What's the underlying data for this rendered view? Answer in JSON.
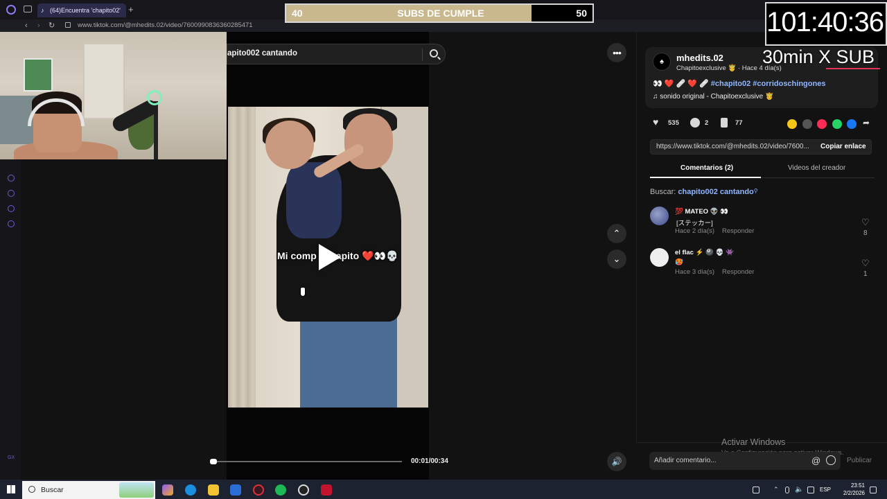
{
  "browser": {
    "tab_title": "(64)Encuentra 'chapito02'",
    "new_tab": "+",
    "url": "www.tiktok.com/@mhedits.02/video/7600990836360285471"
  },
  "search": {
    "value": "apito002 cantando"
  },
  "video": {
    "overlay_caption": "Mi comp  apito ❤️👀💀",
    "time": "00:01/00:34",
    "progress": 0.03
  },
  "author": {
    "avatar_glyph": "♠",
    "name": "mhedits.02",
    "sub": "Chapitoexclusive 🤴 · Hace 4 día(s)",
    "caption_prefix": "👀 ❤️ 🩹 ❤️ 🩹",
    "hashtags": "#chapito02 #corridoschingones",
    "music": "♫  sonido original - Chapitoexclusive 🤴"
  },
  "stats": {
    "likes": "535",
    "comments": "2",
    "saves": "77"
  },
  "share": {
    "link": "https://www.tiktok.com/@mhedits.02/video/7600...",
    "copy_label": "Copiar enlace",
    "colors": [
      "#f5c518",
      "#555555",
      "#fe2c55",
      "#25d366",
      "#1877f2"
    ]
  },
  "tabs": {
    "comments": "Comentarios (2)",
    "creator": "Videos del creador"
  },
  "related_search": {
    "prefix": "Buscar: ",
    "query": "chapito002 cantando"
  },
  "comments": [
    {
      "name": "💯 MATEO 👽 👀",
      "text": "[ステッカー]",
      "meta": "Hace 2 día(s)",
      "reply": "Responder",
      "likes": "8"
    },
    {
      "name": "el flac ⚡ 🎱 💀 👾",
      "text": "🥵",
      "meta": "Hace 3 día(s)",
      "reply": "Responder",
      "likes": "1"
    }
  ],
  "windows_notice": {
    "title": "Activar Windows",
    "sub": "Ve a Configuración para activar Windows."
  },
  "comment_box": {
    "placeholder": "Añadir comentario...",
    "at": "@",
    "publish": "Publicar"
  },
  "overlays": {
    "subs_current": "40",
    "subs_title": "SUBS DE CUMPLE",
    "subs_goal": "50",
    "subs_fraction": 0.8,
    "timer": "101:40:36",
    "timer_sub": "30min X SUB"
  },
  "taskbar": {
    "search": "Buscar",
    "lang": "ESP",
    "time": "23:51",
    "date": "2/2/2026",
    "side_label": "GX"
  }
}
